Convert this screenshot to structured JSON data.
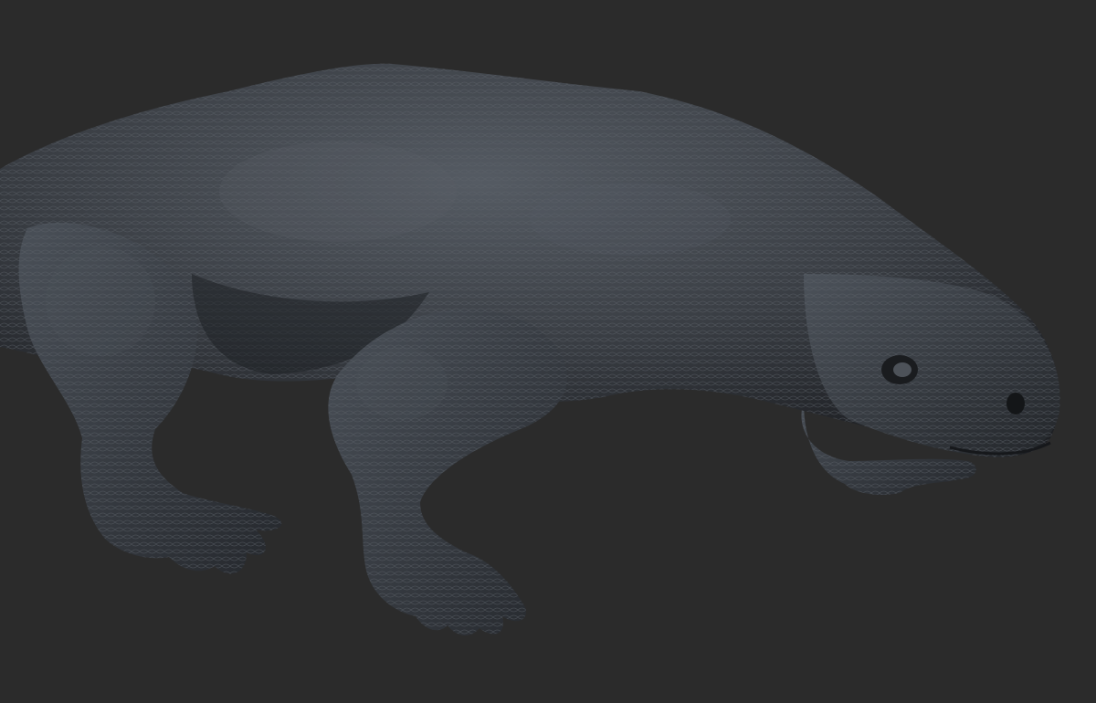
{
  "scene": {
    "background_color": "#2b2b2b",
    "subject": "reptile-sculpt",
    "material_colors": {
      "body_base": "#3a3e44",
      "body_highlight": "#5a6068",
      "body_shadow": "#1e2024",
      "foot": "#4a5058"
    }
  }
}
